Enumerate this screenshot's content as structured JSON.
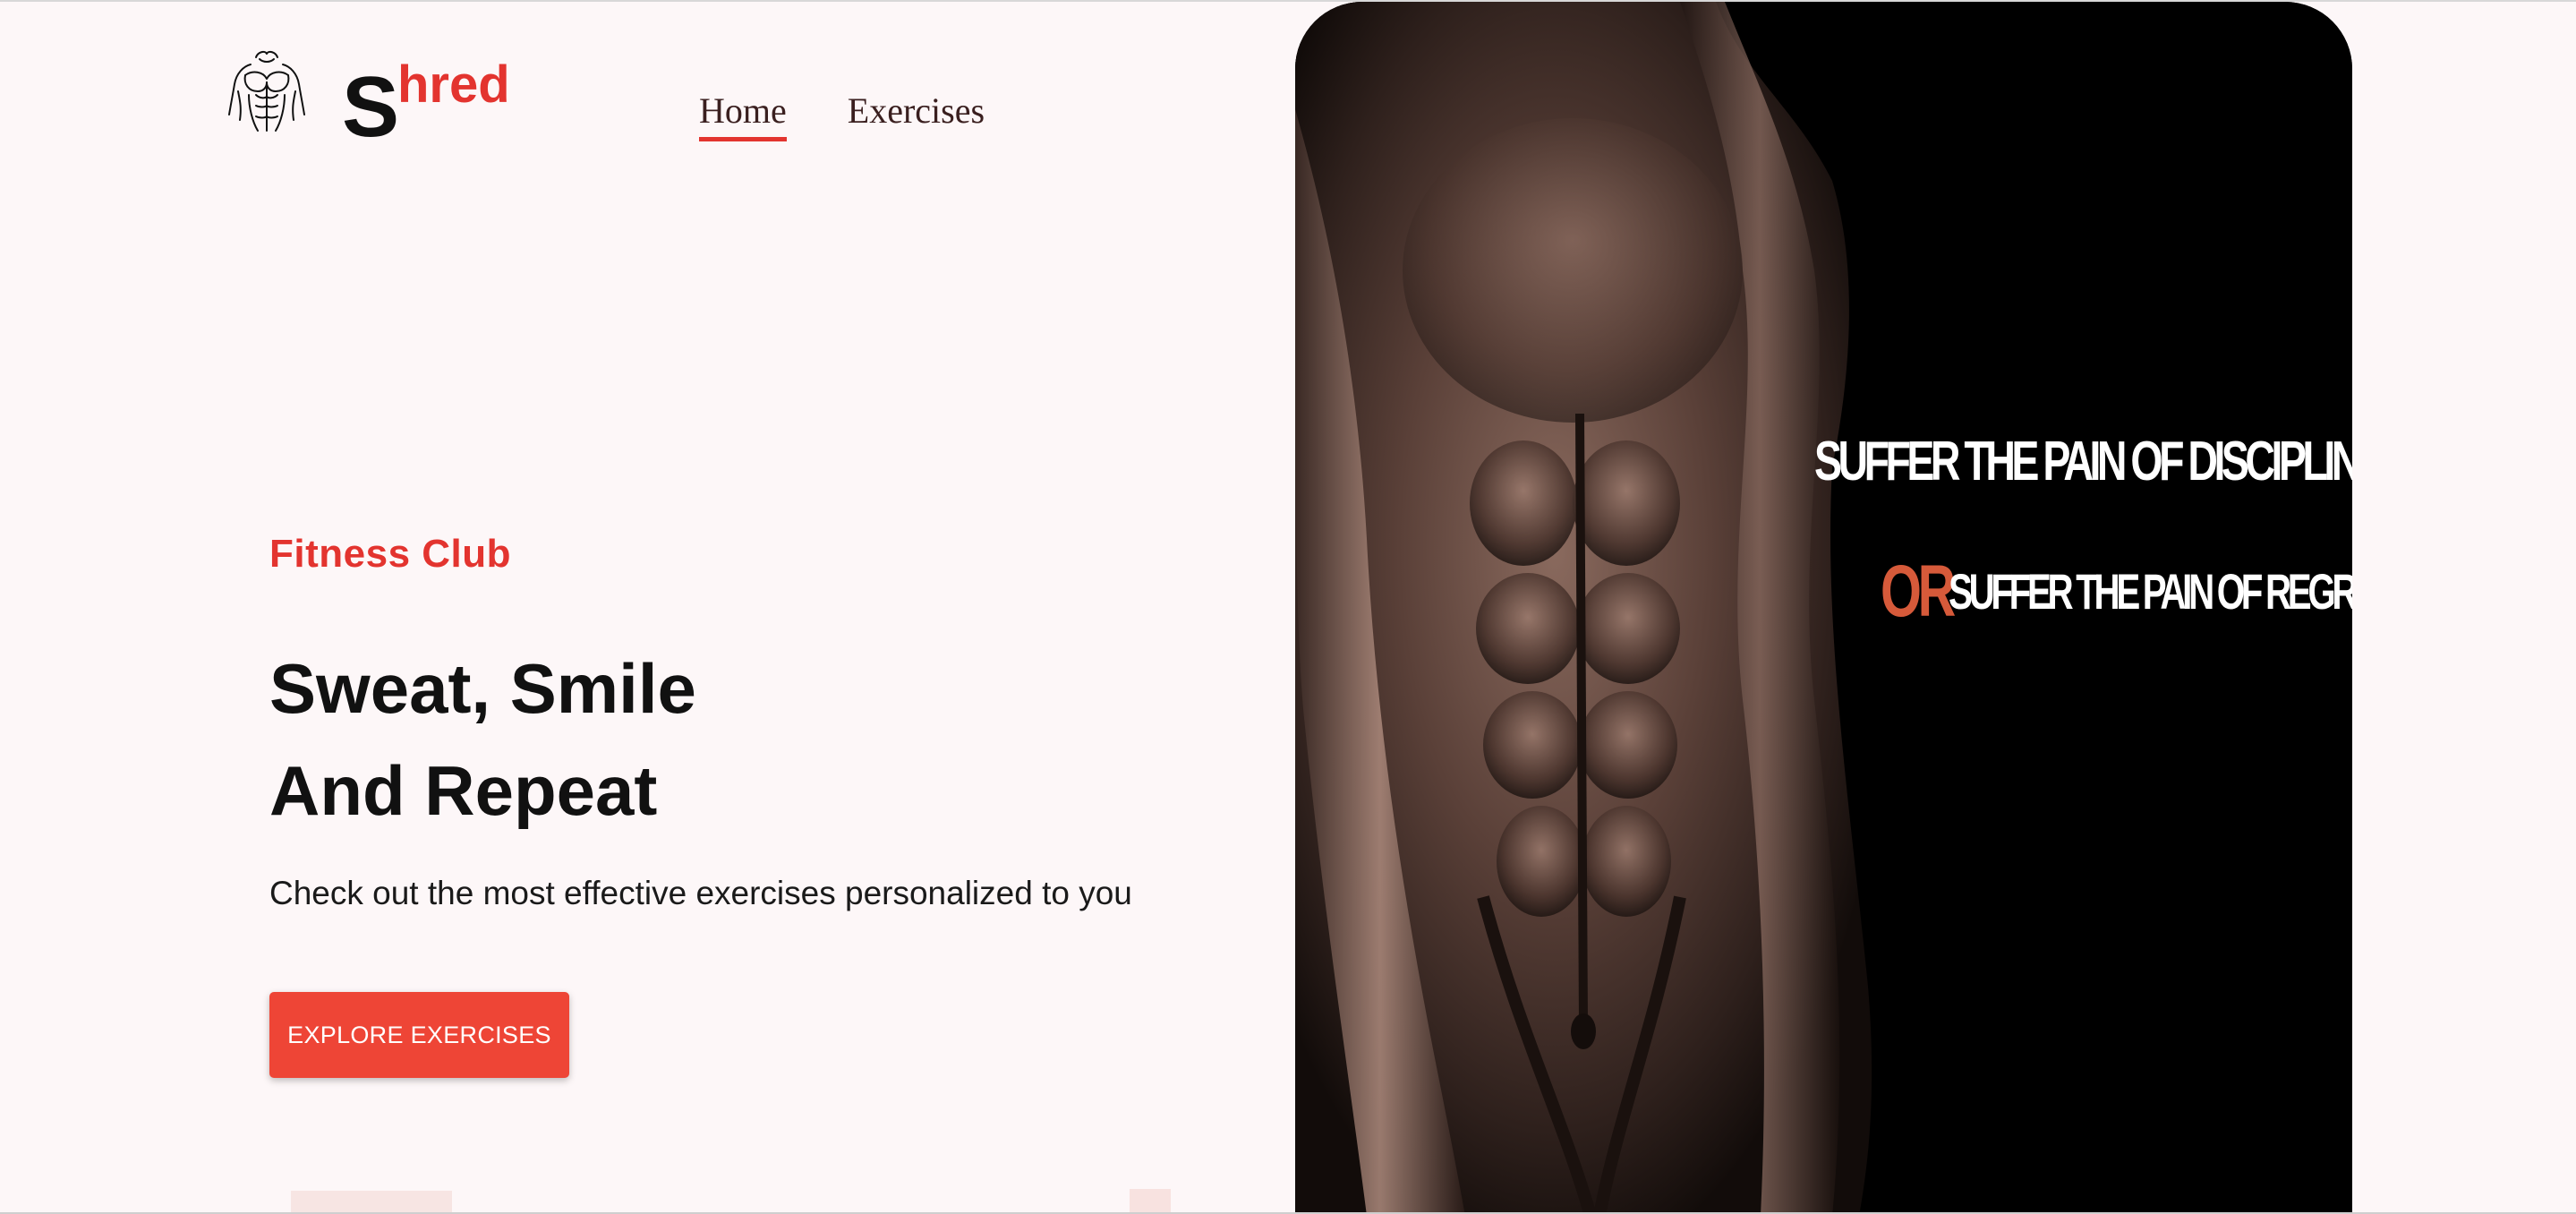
{
  "brand": {
    "logo_icon": "muscle-torso-icon",
    "name_first": "S",
    "name_rest": "hred",
    "accent_color": "#e3342f"
  },
  "nav": {
    "items": [
      {
        "label": "Home",
        "active": true
      },
      {
        "label": "Exercises",
        "active": false
      }
    ]
  },
  "hero": {
    "kicker": "Fitness Club",
    "headline_line1": "Sweat, Smile",
    "headline_line2": "And Repeat",
    "subtitle": "Check out the most effective exercises personalized to you",
    "cta_label": "EXPLORE EXERCISES",
    "cta_color": "#ee4536"
  },
  "banner": {
    "quote_line1": "SUFFER THE PAIN OF DISCIPLINE",
    "quote_or": "OR",
    "quote_line2": "SUFFER THE PAIN OF REGRET",
    "or_color": "#d65a3a"
  }
}
